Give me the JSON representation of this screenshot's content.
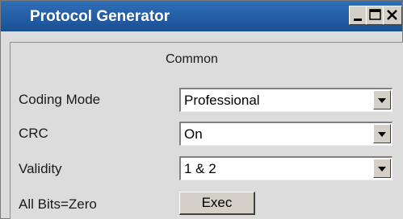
{
  "window": {
    "title": "Protocol Generator",
    "controls": {
      "minimize": "minimize-icon",
      "maximize": "maximize-icon",
      "close": "close-icon"
    }
  },
  "section_title": "Common",
  "fields": [
    {
      "label": "Coding Mode",
      "value": "Professional"
    },
    {
      "label": "CRC",
      "value": "On"
    },
    {
      "label": "Validity",
      "value": "1 & 2"
    }
  ],
  "all_bits": {
    "label": "All Bits=Zero",
    "button_label": "Exec"
  },
  "colors": {
    "titlebar": "#1a4f93",
    "panel": "#dcdcdc"
  }
}
